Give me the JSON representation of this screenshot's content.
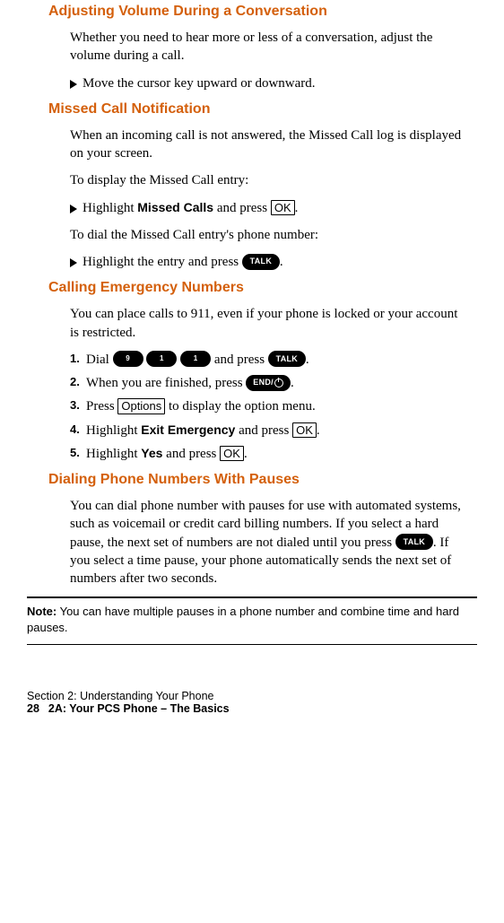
{
  "section1": {
    "heading": "Adjusting Volume During a Conversation",
    "para": "Whether you need to hear more or less of a conversation, adjust the volume during a call.",
    "bullet1": "Move the cursor key upward or downward."
  },
  "section2": {
    "heading": "Missed Call Notification",
    "para1": "When an incoming call is not answered, the Missed Call log is displayed on your screen.",
    "para2": "To display the Missed Call entry:",
    "bullet1_pre": "Highlight ",
    "bullet1_bold": "Missed Calls",
    "bullet1_post1": " and press ",
    "bullet1_post2": ".",
    "para3": "To dial the Missed Call entry's phone number:",
    "bullet2_pre": "Highlight the entry and press ",
    "bullet2_post": "."
  },
  "section3": {
    "heading": "Calling Emergency Numbers",
    "para": "You can place calls to 911, even if your phone is locked or your account is restricted.",
    "step1_pre": "Dial ",
    "step1_mid": " and press ",
    "step1_post": ".",
    "step2_pre": "When you are finished, press ",
    "step2_post": ".",
    "step3_pre": "Press ",
    "step3_post": " to display the option menu.",
    "step4_pre": "Highlight ",
    "step4_bold": "Exit Emergency",
    "step4_mid": " and press ",
    "step4_post": ".",
    "step5_pre": "Highlight ",
    "step5_bold": "Yes",
    "step5_mid": " and press ",
    "step5_post": "."
  },
  "section4": {
    "heading": "Dialing Phone Numbers With Pauses",
    "para_pre": "You can dial phone number with pauses for use with automated systems, such as voicemail or credit card billing numbers. If you select a hard pause, the next set of numbers are not dialed until you press ",
    "para_post": ". If you select a time pause, your phone automatically sends the next set of numbers after two seconds."
  },
  "note": {
    "label": "Note:",
    "text": " You can have multiple pauses in a phone number and combine time and hard pauses."
  },
  "keys": {
    "ok": "OK",
    "talk": "TALK",
    "end": "END/",
    "options": "Options",
    "nine": "9",
    "one": "1"
  },
  "nums": {
    "n1": "1.",
    "n2": "2.",
    "n3": "3.",
    "n4": "4.",
    "n5": "5."
  },
  "footer": {
    "line1": "Section 2: Understanding Your Phone",
    "page": "28",
    "line2": "2A: Your PCS Phone – The Basics"
  }
}
